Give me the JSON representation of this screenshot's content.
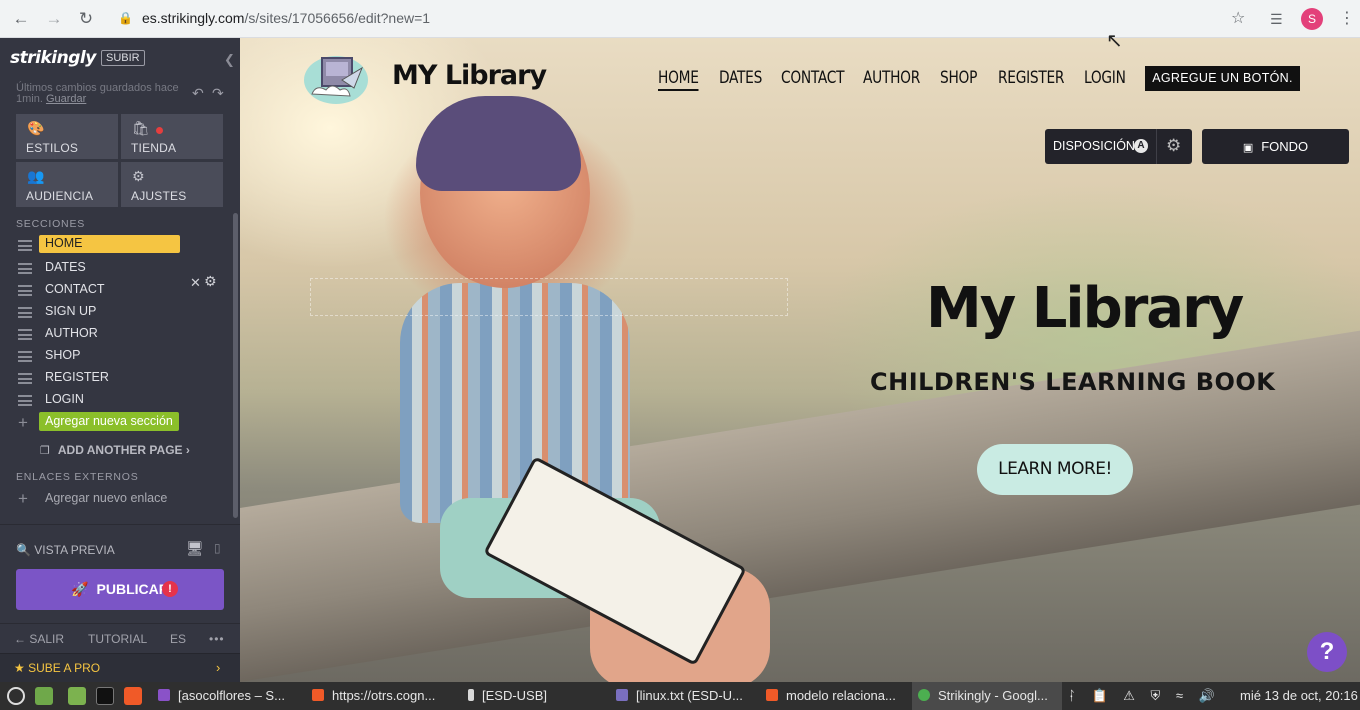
{
  "browser": {
    "url_host": "es.strikingly.com",
    "url_path": "/s/sites/17056656/edit?new=1",
    "profile_initial": "S"
  },
  "sidebar": {
    "logo": "strikingly",
    "upgrade_badge": "SUBIR",
    "saved_text": "Últimos cambios guardados hace 1min.",
    "save_link": "Guardar",
    "tiles": [
      {
        "label": "ESTILOS",
        "icon": "palette-icon"
      },
      {
        "label": "TIENDA",
        "icon": "bag-icon"
      },
      {
        "label": "AUDIENCIA",
        "icon": "people-icon"
      },
      {
        "label": "AJUSTES",
        "icon": "gear-icon"
      }
    ],
    "sections_header": "SECCIONES",
    "sections": [
      "HOME",
      "DATES",
      "CONTACT",
      "SIGN UP",
      "AUTHOR",
      "SHOP",
      "REGISTER",
      "LOGIN"
    ],
    "add_section": "Agregar nueva sección",
    "add_page": "ADD ANOTHER PAGE",
    "external_header": "ENLACES EXTERNOS",
    "add_link": "Agregar nuevo enlace",
    "preview": "VISTA PREVIA",
    "publish": "PUBLICAR",
    "publish_badge": "!",
    "exit": "SALIR",
    "tutorial": "TUTORIAL",
    "lang": "ES",
    "more": "•••",
    "pro": "SUBE A PRO"
  },
  "site": {
    "title": "MY Library",
    "nav": [
      "HOME",
      "DATES",
      "CONTACT",
      "AUTHOR",
      "SHOP",
      "REGISTER",
      "LOGIN"
    ],
    "nav_button": "AGREGUE UN BOTÓN.",
    "layout_button": "DISPOSICIÓN",
    "layout_badge": "A",
    "background_button": "FONDO",
    "hero_title": "My Library",
    "hero_subtitle": "CHILDREN'S LEARNING BOOK",
    "cta": "LEARN MORE!",
    "help": "?"
  },
  "taskbar": {
    "items": [
      {
        "label": "[asocolflores – S...",
        "color": "#8a52c8"
      },
      {
        "label": "https://otrs.cogn...",
        "color": "#f05a28"
      },
      {
        "label": "[ESD-USB]",
        "color": "#d8d8d8"
      },
      {
        "label": "[linux.txt (ESD-U...",
        "color": "#7a6fbf"
      },
      {
        "label": "modelo relaciona...",
        "color": "#f05a28"
      },
      {
        "label": "Strikingly - Googl...",
        "color": "#4caf50"
      }
    ],
    "clock": "mié 13 de oct, 20:16"
  },
  "colors": {
    "sidebar_bg": "#343641",
    "accent_yellow": "#f5c542",
    "add_green": "#8bbf2a",
    "publish_purple": "#7b55c6",
    "cta_mint": "#c9ebe3"
  }
}
